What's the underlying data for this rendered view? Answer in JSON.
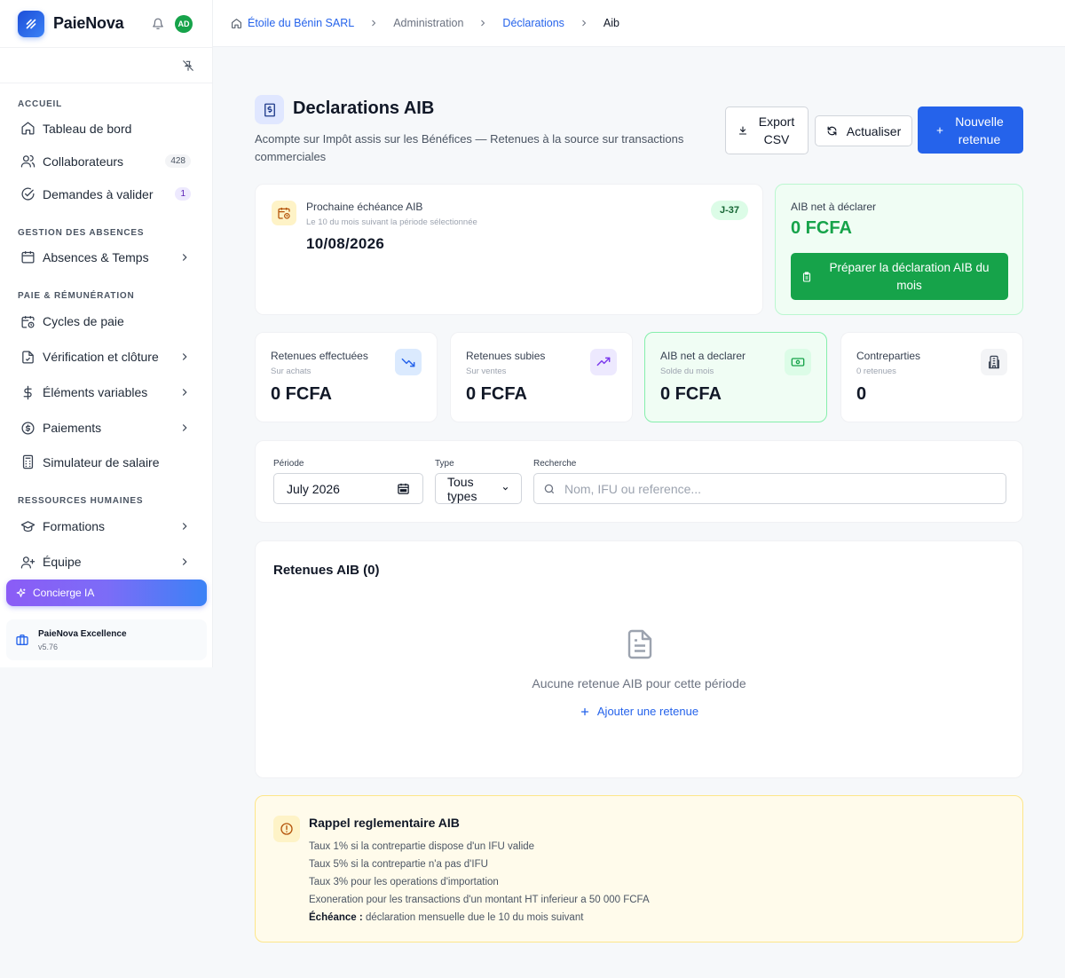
{
  "brand": {
    "name": "PaieNova",
    "avatar_initials": "AD"
  },
  "sidebar": {
    "sections": [
      {
        "title": "ACCUEIL",
        "items": [
          {
            "label": "Tableau de bord",
            "icon": "home-icon"
          },
          {
            "label": "Collaborateurs",
            "icon": "users-icon",
            "badge": "428"
          },
          {
            "label": "Demandes à valider",
            "icon": "check-circle-icon",
            "badge": "1"
          }
        ]
      },
      {
        "title": "GESTION DES ABSENCES",
        "items": [
          {
            "label": "Absences & Temps",
            "icon": "calendar-icon"
          }
        ]
      },
      {
        "title": "PAIE & RÉMUNÉRATION",
        "items": [
          {
            "label": "Cycles de paie",
            "icon": "calendar-clock-icon"
          },
          {
            "label": "Vérification et clôture",
            "icon": "file-check-icon"
          },
          {
            "label": "Éléments variables",
            "icon": "dollar-icon"
          },
          {
            "label": "Paiements",
            "icon": "coin-icon"
          },
          {
            "label": "Simulateur de salaire",
            "icon": "calculator-icon"
          }
        ]
      },
      {
        "title": "RESSOURCES HUMAINES",
        "items": [
          {
            "label": "Formations",
            "icon": "graduation-cap-icon"
          },
          {
            "label": "Équipe",
            "icon": "user-plus-icon"
          }
        ]
      }
    ],
    "concierge_label": "Concierge IA",
    "plan": {
      "name": "PaieNova Excellence",
      "version": "v5.76"
    }
  },
  "breadcrumb": {
    "company": "Étoile du Bénin SARL",
    "admin": "Administration",
    "declarations": "Déclarations",
    "current": "Aib"
  },
  "header": {
    "title": "Declarations AIB",
    "subtitle": "Acompte sur Impôt assis sur les Bénéfices — Retenues à la source sur transactions commerciales",
    "export_label": "Export CSV",
    "refresh_label": "Actualiser",
    "new_label": "Nouvelle retenue"
  },
  "due": {
    "label": "Prochaine échéance AIB",
    "hint": "Le 10 du mois suivant la période sélectionnée",
    "date": "10/08/2026",
    "countdown": "J-37"
  },
  "net": {
    "label": "AIB net à déclarer",
    "value": "0 FCFA",
    "prepare_label": "Préparer la déclaration AIB du mois"
  },
  "stats": [
    {
      "label": "Retenues effectuées",
      "sub": "Sur achats",
      "value": "0 FCFA",
      "icon": "trending-down-icon",
      "color": "#2563eb"
    },
    {
      "label": "Retenues subies",
      "sub": "Sur ventes",
      "value": "0 FCFA",
      "icon": "trending-up-icon",
      "color": "#7c3aed"
    },
    {
      "label": "AIB net a declarer",
      "sub": "Solde du mois",
      "value": "0 FCFA",
      "icon": "banknote-icon",
      "color": "#16a34a"
    },
    {
      "label": "Contreparties",
      "sub": "0 retenues",
      "value": "0",
      "icon": "building-icon",
      "color": "#374151"
    }
  ],
  "filters": {
    "period_label": "Période",
    "period_value": "July 2026",
    "type_label": "Type",
    "type_value": "Tous types",
    "search_label": "Recherche",
    "search_placeholder": "Nom, IFU ou reference..."
  },
  "list": {
    "title": "Retenues AIB (0)",
    "empty_text": "Aucune retenue AIB pour cette période",
    "add_label": "Ajouter une retenue"
  },
  "rappel": {
    "title": "Rappel reglementaire AIB",
    "lines": [
      "Taux 1% si la contrepartie dispose d'un IFU valide",
      "Taux 5% si la contrepartie n'a pas d'IFU",
      "Taux 3% pour les operations d'importation",
      "Exoneration pour les transactions d'un montant HT inferieur a 50 000 FCFA"
    ],
    "deadline_label": "Échéance :",
    "deadline_text": "déclaration mensuelle due le 10 du mois suivant"
  }
}
